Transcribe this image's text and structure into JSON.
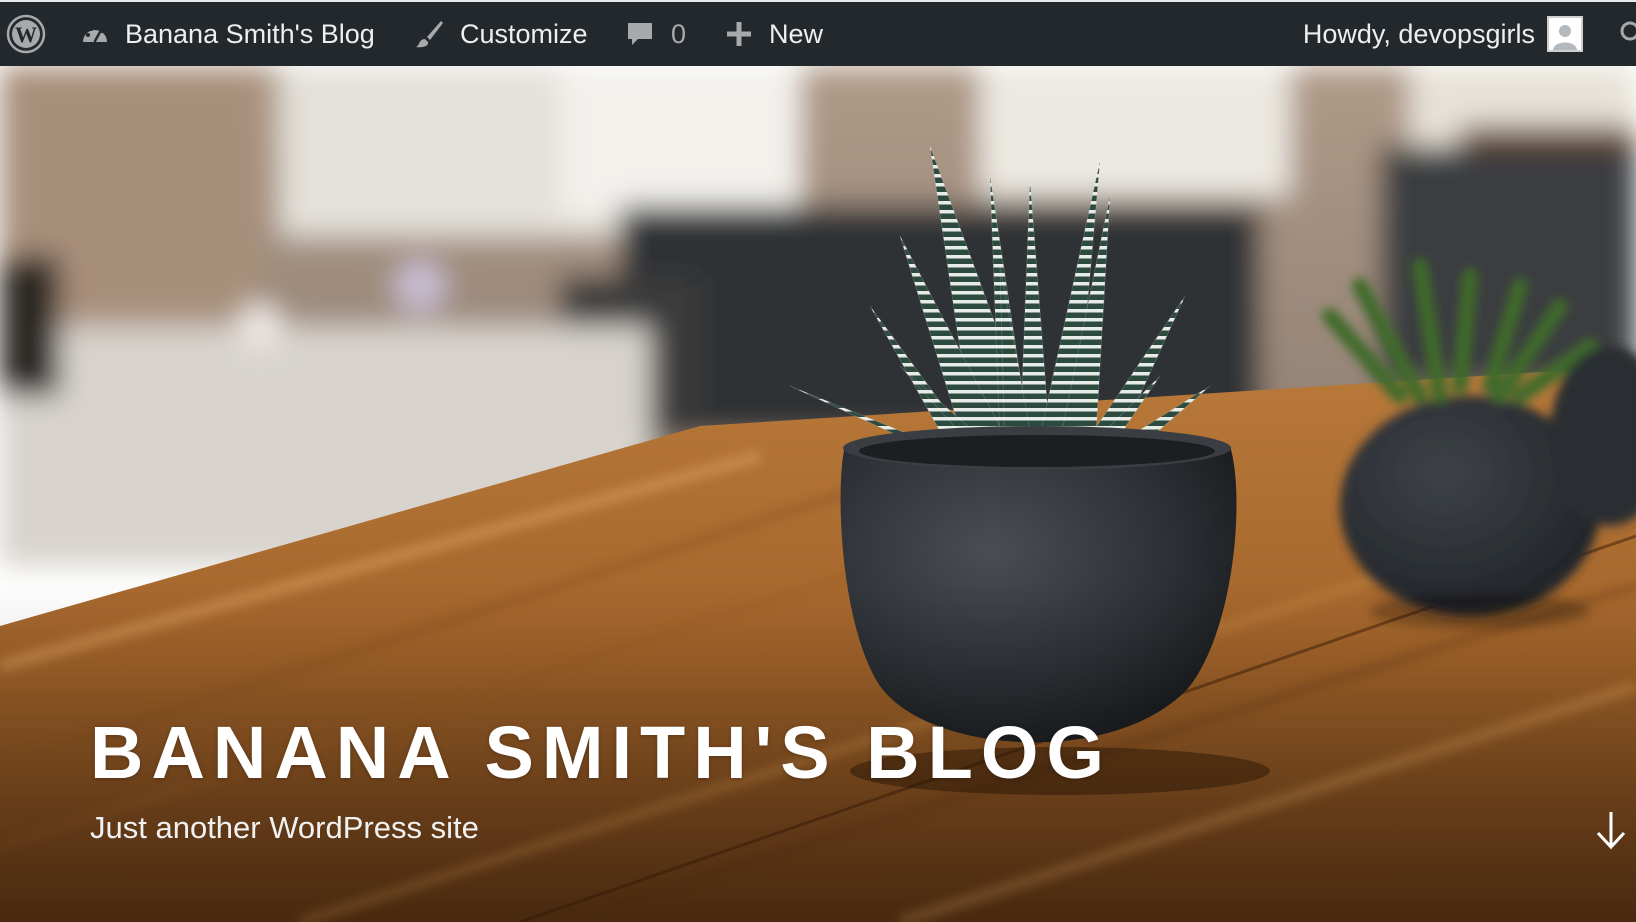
{
  "admin_bar": {
    "wp_logo_icon": "wordpress-logo-icon",
    "site_name": "Banana Smith's Blog",
    "site_icon": "dashboard-icon",
    "customize_label": "Customize",
    "customize_icon": "paintbrush-icon",
    "comments_count": "0",
    "comments_icon": "comment-bubble-icon",
    "new_label": "New",
    "new_icon": "plus-icon",
    "account_greeting": "Howdy, devopsgirls",
    "avatar_icon": "user-avatar-icon",
    "search_icon": "search-icon"
  },
  "header": {
    "site_title": "BANANA SMITH'S BLOG",
    "site_description": "Just another WordPress site",
    "scroll_icon": "arrow-down-icon"
  },
  "colors": {
    "admin_bar_bg": "#23282d",
    "admin_bar_text": "#eeeeee",
    "title_text": "#ffffff"
  }
}
